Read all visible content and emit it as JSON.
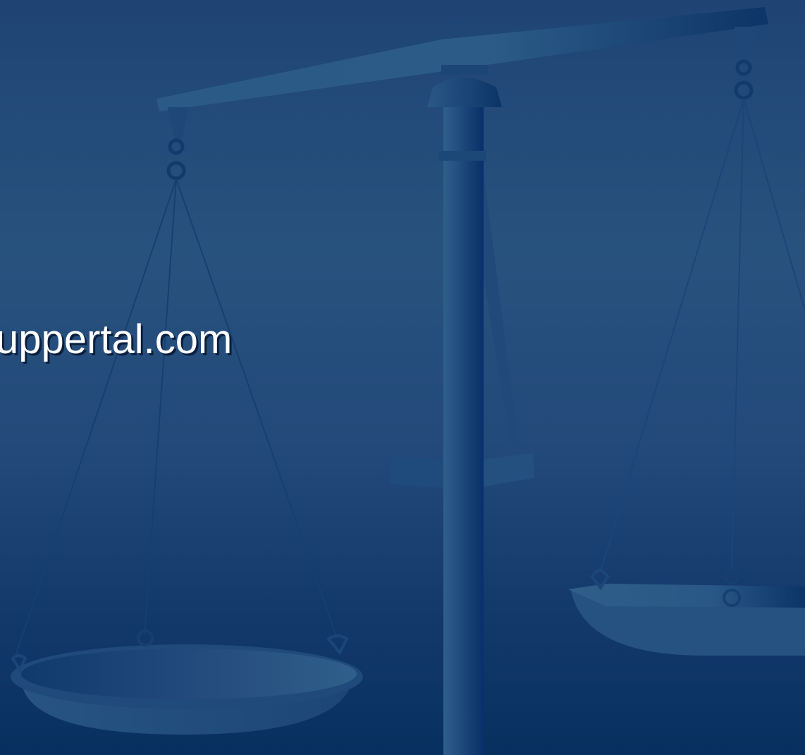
{
  "slide": {
    "text": "uppertal.com",
    "background_colors": [
      "#1f4474",
      "#28527e",
      "#07305f"
    ],
    "text_color": "#ffffff"
  },
  "background_image": {
    "subject": "scales-of-justice"
  }
}
